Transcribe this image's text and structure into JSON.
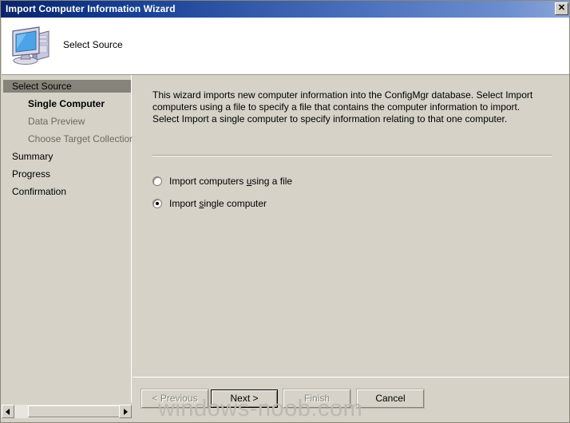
{
  "window": {
    "title": "Import Computer Information Wizard",
    "close_icon": "close-icon",
    "close_glyph": "✕"
  },
  "header": {
    "title": "Select Source",
    "icon": "computer-icon"
  },
  "sidebar": {
    "items": [
      {
        "label": "Select Source",
        "state": "current",
        "level": 0
      },
      {
        "label": "Single Computer",
        "state": "active-sub",
        "level": 1
      },
      {
        "label": "Data Preview",
        "state": "dim",
        "level": 1
      },
      {
        "label": "Choose Target Collection",
        "state": "dim",
        "level": 1
      },
      {
        "label": "Summary",
        "state": "normal",
        "level": 0
      },
      {
        "label": "Progress",
        "state": "normal",
        "level": 0
      },
      {
        "label": "Confirmation",
        "state": "normal",
        "level": 0
      }
    ],
    "scrollbar": {
      "left_arrow_icon": "scroll-left-arrow-icon",
      "right_arrow_icon": "scroll-right-arrow-icon"
    }
  },
  "content": {
    "description": "This wizard imports new computer information into the ConfigMgr database. Select Import computers using a file to specify a file that contains the computer information to import. Select Import a single computer to specify information relating to that one computer.",
    "options": [
      {
        "label_before": "Import computers ",
        "accel": "u",
        "label_after": "sing a file",
        "checked": false,
        "name": "import-computers-using-file"
      },
      {
        "label_before": "Import ",
        "accel": "s",
        "label_after": "ingle computer",
        "checked": true,
        "name": "import-single-computer"
      }
    ]
  },
  "buttons": {
    "previous": {
      "label": "< Previous",
      "enabled": false
    },
    "next": {
      "label": "Next >",
      "enabled": true,
      "default": true
    },
    "finish": {
      "label": "Finish",
      "enabled": false
    },
    "cancel": {
      "label": "Cancel",
      "enabled": true
    }
  },
  "watermark": {
    "text": "windows-noob.com"
  },
  "colors": {
    "titlebar_start": "#0a246a",
    "titlebar_end": "#8ba6d9",
    "dialog_face": "#d6d2c8",
    "sidebar_highlight": "#86837a",
    "header_background": "#ffffff",
    "watermark": "#bdb9b0"
  }
}
